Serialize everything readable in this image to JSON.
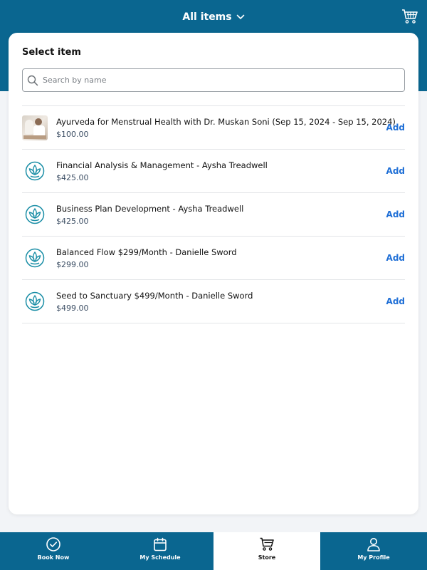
{
  "header": {
    "title": "All items",
    "title_icon": "chevron-down-icon",
    "cart_icon": "cart-icon"
  },
  "card": {
    "title": "Select item",
    "search": {
      "placeholder": "Search by name",
      "value": ""
    }
  },
  "items": [
    {
      "name": "Ayurveda for Menstrual Health with Dr. Muskan Soni (Sep 15, 2024 - Sep 15, 2024)",
      "price": "$100.00",
      "thumb": "photo",
      "add_label": "Add"
    },
    {
      "name": "Financial Analysis & Management - Aysha Treadwell",
      "price": "$425.00",
      "thumb": "lotus-logo-icon",
      "add_label": "Add"
    },
    {
      "name": "Business Plan Development - Aysha Treadwell",
      "price": "$425.00",
      "thumb": "lotus-logo-icon",
      "add_label": "Add"
    },
    {
      "name": "Balanced Flow $299/Month - Danielle Sword",
      "price": "$299.00",
      "thumb": "lotus-logo-icon",
      "add_label": "Add"
    },
    {
      "name": "Seed to Sanctuary $499/Month - Danielle Sword",
      "price": "$499.00",
      "thumb": "lotus-logo-icon",
      "add_label": "Add"
    }
  ],
  "bottom_nav": [
    {
      "label": "Book Now",
      "icon": "check-circle-icon",
      "active": false
    },
    {
      "label": "My Schedule",
      "icon": "calendar-icon",
      "active": false
    },
    {
      "label": "Store",
      "icon": "cart-icon",
      "active": true
    },
    {
      "label": "My Profile",
      "icon": "person-icon",
      "active": false
    }
  ],
  "colors": {
    "brand": "#0a6690",
    "accent": "#1f6fd6",
    "logo": "#1a8ea6"
  }
}
